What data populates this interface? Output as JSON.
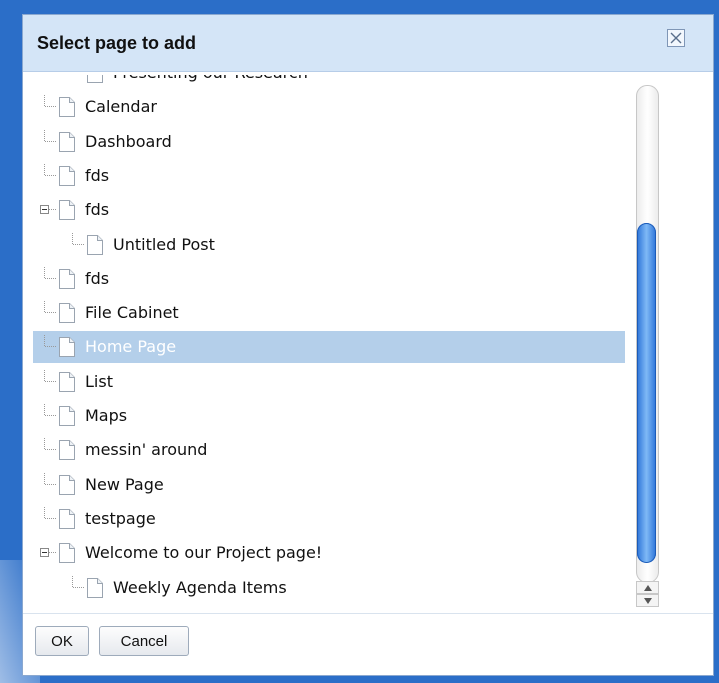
{
  "dialog": {
    "title": "Select page to add",
    "close_icon": "close-icon"
  },
  "tree": {
    "items": [
      {
        "label": "Presenting our Research",
        "level": 1,
        "expandable": false,
        "partial": true
      },
      {
        "label": "Calendar",
        "level": 0,
        "expandable": false
      },
      {
        "label": "Dashboard",
        "level": 0,
        "expandable": false
      },
      {
        "label": "fds",
        "level": 0,
        "expandable": false
      },
      {
        "label": "fds",
        "level": 0,
        "expandable": true
      },
      {
        "label": "Untitled Post",
        "level": 1,
        "expandable": false
      },
      {
        "label": "fds",
        "level": 0,
        "expandable": false
      },
      {
        "label": "File Cabinet",
        "level": 0,
        "expandable": false
      },
      {
        "label": "Home Page",
        "level": 0,
        "expandable": false,
        "selected": true
      },
      {
        "label": "List",
        "level": 0,
        "expandable": false
      },
      {
        "label": "Maps",
        "level": 0,
        "expandable": false
      },
      {
        "label": "messin' around",
        "level": 0,
        "expandable": false
      },
      {
        "label": "New Page",
        "level": 0,
        "expandable": false
      },
      {
        "label": "testpage",
        "level": 0,
        "expandable": false
      },
      {
        "label": "Welcome to our Project page!",
        "level": 0,
        "expandable": true
      },
      {
        "label": "Weekly Agenda Items",
        "level": 1,
        "expandable": false
      }
    ]
  },
  "footer": {
    "ok_label": "OK",
    "cancel_label": "Cancel"
  },
  "colors": {
    "titlebar": "#d4e5f7",
    "selection": "#b4cfea",
    "frame": "#2b6ec8"
  }
}
